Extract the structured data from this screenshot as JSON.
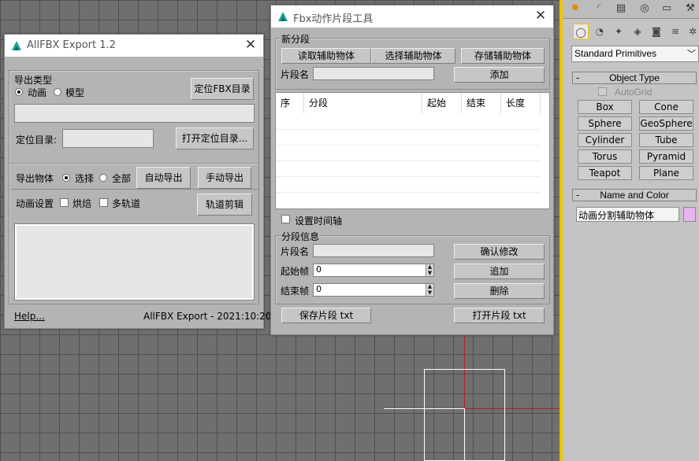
{
  "colors": {
    "viewport_bg": "#6f6f6f",
    "window_bg": "#b4b4b4",
    "swatch": "#e8b4f0",
    "axis_red": "#b02020",
    "selection_yellow": "#f0c400"
  },
  "allfbx": {
    "title": "AllFBX Export 1.2",
    "export_type_label": "导出类型",
    "radio_anim": "动画",
    "radio_model": "模型",
    "locate_fbx_btn": "定位FBX目录",
    "locate_dir_label": "定位目录:",
    "open_dir_btn": "打开定位目录...",
    "export_obj_label": "导出物体",
    "radio_select": "选择",
    "radio_all": "全部",
    "auto_export_btn": "自动导出",
    "manual_export_btn": "手动导出",
    "anim_settings_label": "动画设置",
    "bake_label": "烘焙",
    "multitrack_label": "多轨道",
    "track_edit_btn": "轨道剪辑",
    "help_link": "Help...",
    "footer_text": "AllFBX Export  - 2021:10:20"
  },
  "fbxclip": {
    "title": "Fbx动作片段工具",
    "new_segment_group": "新分段",
    "read_helper_btn": "读取辅助物体",
    "select_helper_btn": "选择辅助物体",
    "store_helper_btn": "存储辅助物体",
    "segment_name_label": "片段名",
    "add_btn": "添加",
    "table_headers": [
      "序",
      "分段",
      "起始",
      "结束",
      "长度"
    ],
    "set_timeline_label": "设置时间轴",
    "segment_info_group": "分段信息",
    "segment_name_label2": "片段名",
    "confirm_btn": "确认修改",
    "start_frame_label": "起始帧",
    "start_frame_value": "0",
    "append_btn": "追加",
    "end_frame_label": "结束帧",
    "end_frame_value": "0",
    "delete_btn": "删除",
    "save_txt_btn": "保存片段 txt",
    "open_txt_btn": "打开片段 txt"
  },
  "command_panel": {
    "dropdown_value": "Standard Primitives",
    "object_type_header": "Object Type",
    "autogrid_label": "AutoGrid",
    "primitives": [
      "Box",
      "Cone",
      "Sphere",
      "GeoSphere",
      "Cylinder",
      "Tube",
      "Torus",
      "Pyramid",
      "Teapot",
      "Plane"
    ],
    "name_color_header": "Name and Color",
    "object_name": "动画分割辅助物体"
  }
}
